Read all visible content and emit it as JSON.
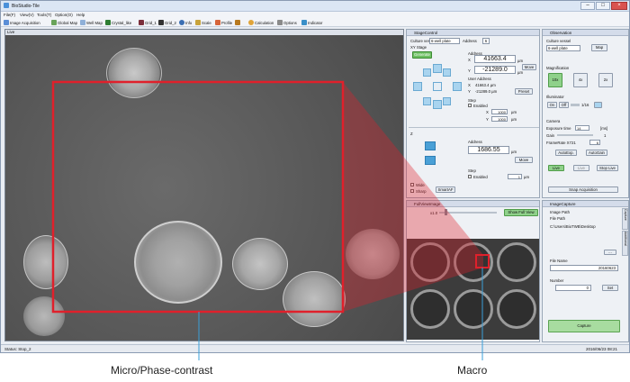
{
  "window": {
    "title": "BioStudio-Tile"
  },
  "menu": [
    "File(F)",
    "View(V)",
    "Tools(T)",
    "Option(O)",
    "Help"
  ],
  "toolbar": [
    "Image Acquisition",
    "Global Map",
    "Well Map",
    "Crystal_like",
    "Grid_1",
    "Grid_2",
    "Info",
    "Scale",
    "Profile",
    "Calculation",
    "Options",
    "Indicator"
  ],
  "live": {
    "header": "Live"
  },
  "stage": {
    "title": "StageControl",
    "culture_vessel_label": "Culture vessel",
    "culture_vessel_value": "6-well plate",
    "address_label": "Address",
    "address_value": "6",
    "xy_stage_label": "XY Stage",
    "generate_button": "Generate",
    "address_heading": "Address",
    "x_label": "X",
    "x_value": "41663.4",
    "y_label": "Y",
    "y_value": "-21289.0",
    "unit": "µm",
    "move_button": "Move",
    "user_address_label": "User Address",
    "ux_value": "41663.4 µm",
    "uy_value": "-21289.0 µm",
    "preset_button": "Preset",
    "step_label": "Step",
    "enabled_label": "Enabled",
    "step_x_value": "1000",
    "step_y_value": "1000",
    "z_label": "Z",
    "z_address_label": "Address",
    "z_value": "1686.55",
    "z_move_button": "Move",
    "z_step_label": "Step",
    "z_enabled_label": "Enabled",
    "z_step_value": "1",
    "wide_label": "Wide",
    "sharp_label": "Sharp",
    "smart_af_button": "SmartAF"
  },
  "fullview": {
    "title": "FullViewImage",
    "zoom": "x1.0",
    "show_button": "Show Full View"
  },
  "observation": {
    "title": "Observation",
    "culture_vessel_label": "Culture vessel",
    "vessel_value": "6-well plate",
    "map_button": "Map",
    "magnification_label": "Magnification",
    "mag_10x": "10x",
    "mag_4x": "4x",
    "mag_2x": "2x",
    "illuminator_label": "Illuminator",
    "on": "On",
    "off": "Off",
    "level": "1/16",
    "camera_label": "Camera",
    "exposure_label": "Exposure time",
    "exposure_value": "14",
    "exposure_unit": "[ms]",
    "gain_label": "Gain",
    "gain_value": "1",
    "framerate_label": "FrameRate X721",
    "framerate_value": "6",
    "auto_exp": "AutoExp.",
    "auto_gain": "AutoGain",
    "live": "Live",
    "live2": "Live",
    "stop_live": "Stop Live",
    "snap": "Snap Acquisition"
  },
  "capture": {
    "title": "ImageCapture",
    "image_path_label": "Image Path",
    "file_path_label": "File Path",
    "file_path_value": "C:\\Users\\BioTWB\\Desktop",
    "browse_button": "...",
    "file_name_label": "File Name",
    "file_name_value": "20160623",
    "number_label": "Number",
    "number_value": "0",
    "set_button": "Set",
    "capture_button": "Capture",
    "side_tab_1": "Capture",
    "side_tab_2": "Additional"
  },
  "status": {
    "text": "Status: Stop_2",
    "time": "2016/06/23 08:21"
  },
  "captions": {
    "micro": "Micro/Phase-contrast",
    "macro": "Macro"
  },
  "colors": {
    "highlight": "#e0202b",
    "callout_line": "#3a9fd8"
  }
}
